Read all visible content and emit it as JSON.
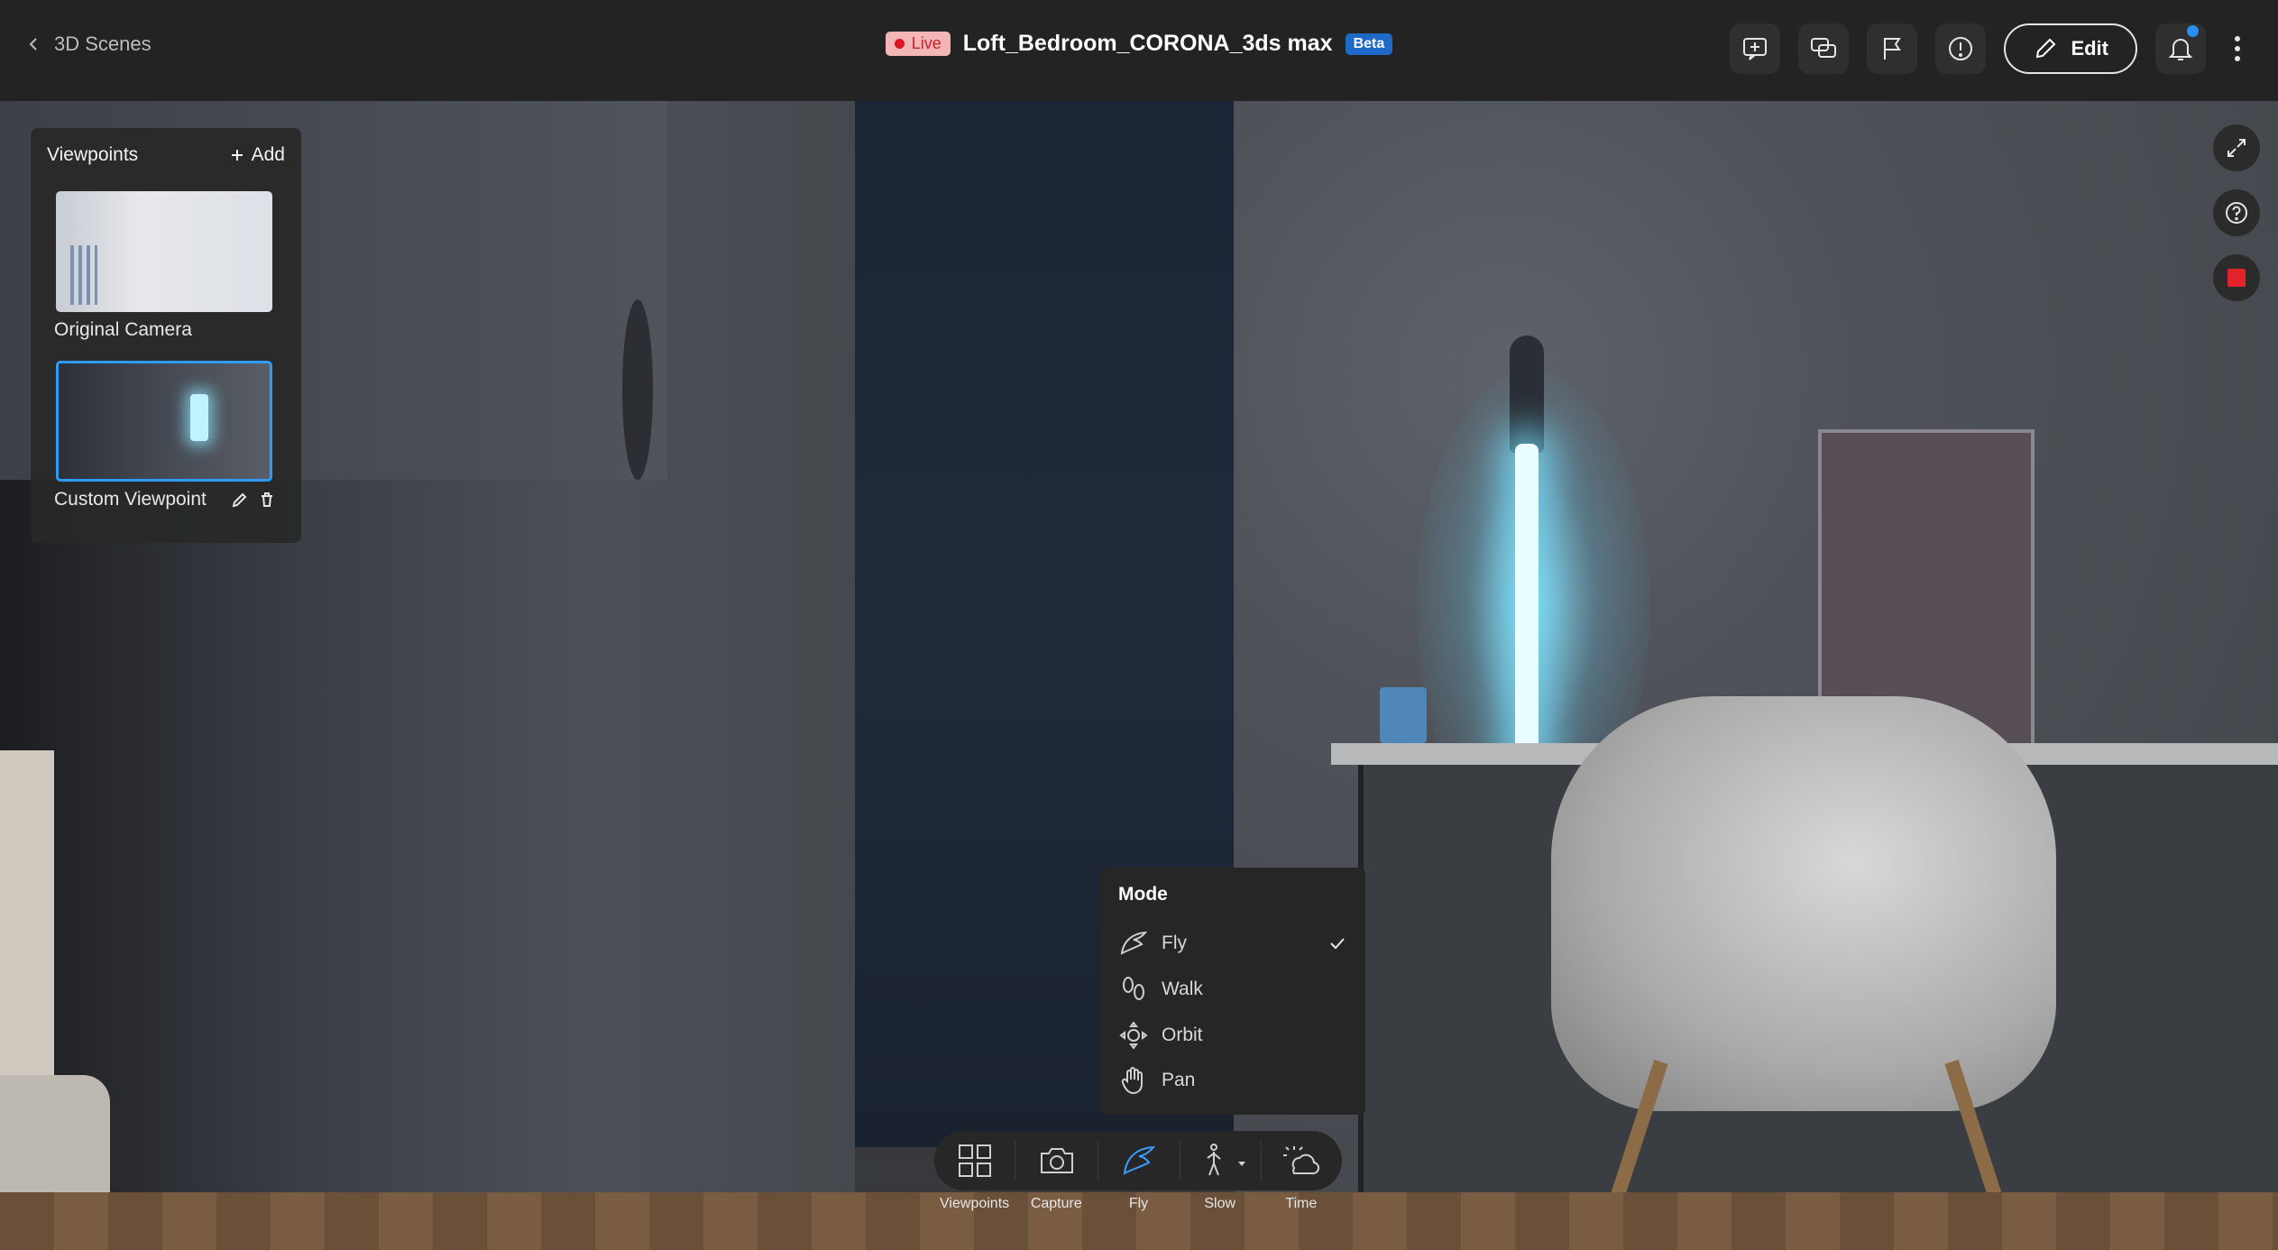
{
  "header": {
    "back_label": "3D Scenes",
    "live_label": "Live",
    "scene_title": "Loft_Bedroom_CORONA_3ds max",
    "beta_label": "Beta",
    "edit_label": "Edit"
  },
  "viewpoints_panel": {
    "title": "Viewpoints",
    "add_label": "Add",
    "items": [
      {
        "label": "Original Camera"
      },
      {
        "label": "Custom Viewpoint"
      }
    ]
  },
  "mode_menu": {
    "title": "Mode",
    "items": [
      {
        "label": "Fly",
        "selected": true
      },
      {
        "label": "Walk"
      },
      {
        "label": "Orbit"
      },
      {
        "label": "Pan"
      }
    ]
  },
  "toolbar": {
    "viewpoints_label": "Viewpoints",
    "capture_label": "Capture",
    "fly_label": "Fly",
    "slow_label": "Slow",
    "time_label": "Time"
  },
  "colors": {
    "accent": "#2f9bff",
    "live_dot": "#d8171f",
    "beta": "#1f6ac9",
    "stop": "#e2232c"
  }
}
